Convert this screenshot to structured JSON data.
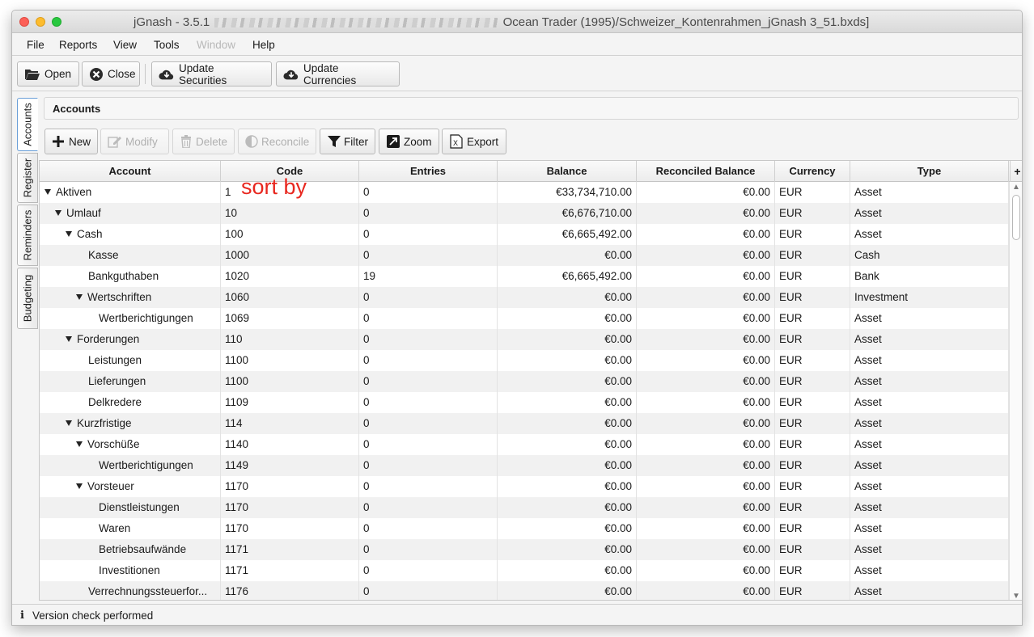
{
  "window": {
    "title_prefix": "jGnash - 3.5.1",
    "title_suffix": "Ocean Trader (1995)/Schweizer_Kontenrahmen_jGnash 3_51.bxds]"
  },
  "menu": {
    "file": "File",
    "reports": "Reports",
    "view": "View",
    "tools": "Tools",
    "window": "Window",
    "help": "Help"
  },
  "toolbar": {
    "open": "Open",
    "close": "Close",
    "update_securities": "Update Securities",
    "update_currencies": "Update Currencies"
  },
  "side_tabs": {
    "accounts": "Accounts",
    "register": "Register",
    "reminders": "Reminders",
    "budgeting": "Budgeting"
  },
  "panel": {
    "title": "Accounts"
  },
  "account_toolbar": {
    "new": "New",
    "modify": "Modify",
    "delete": "Delete",
    "reconcile": "Reconcile",
    "filter": "Filter",
    "zoom": "Zoom",
    "export": "Export"
  },
  "table": {
    "columns": [
      "Account",
      "Code",
      "Entries",
      "Balance",
      "Reconciled Balance",
      "Currency",
      "Type"
    ],
    "add_column": "+",
    "rows": [
      {
        "account": "Aktiven",
        "level": 0,
        "expanded": true,
        "code": "1",
        "entries": "0",
        "balance": "€33,734,710.00",
        "reconciled": "€0.00",
        "currency": "EUR",
        "type": "Asset"
      },
      {
        "account": "Umlauf",
        "level": 1,
        "expanded": true,
        "code": "10",
        "entries": "0",
        "balance": "€6,676,710.00",
        "reconciled": "€0.00",
        "currency": "EUR",
        "type": "Asset"
      },
      {
        "account": "Cash",
        "level": 2,
        "expanded": true,
        "code": "100",
        "entries": "0",
        "balance": "€6,665,492.00",
        "reconciled": "€0.00",
        "currency": "EUR",
        "type": "Asset"
      },
      {
        "account": "Kasse",
        "level": 3,
        "expanded": false,
        "code": "1000",
        "entries": "0",
        "balance": "€0.00",
        "reconciled": "€0.00",
        "currency": "EUR",
        "type": "Cash"
      },
      {
        "account": "Bankguthaben",
        "level": 3,
        "expanded": false,
        "code": "1020",
        "entries": "19",
        "balance": "€6,665,492.00",
        "reconciled": "€0.00",
        "currency": "EUR",
        "type": "Bank"
      },
      {
        "account": "Wertschriften",
        "level": 3,
        "expanded": true,
        "code": "1060",
        "entries": "0",
        "balance": "€0.00",
        "reconciled": "€0.00",
        "currency": "EUR",
        "type": "Investment"
      },
      {
        "account": "Wertberichtigungen",
        "level": 4,
        "expanded": false,
        "code": "1069",
        "entries": "0",
        "balance": "€0.00",
        "reconciled": "€0.00",
        "currency": "EUR",
        "type": "Asset"
      },
      {
        "account": "Forderungen",
        "level": 2,
        "expanded": true,
        "code": "110",
        "entries": "0",
        "balance": "€0.00",
        "reconciled": "€0.00",
        "currency": "EUR",
        "type": "Asset"
      },
      {
        "account": "Leistungen",
        "level": 3,
        "expanded": false,
        "code": "1100",
        "entries": "0",
        "balance": "€0.00",
        "reconciled": "€0.00",
        "currency": "EUR",
        "type": "Asset"
      },
      {
        "account": "Lieferungen",
        "level": 3,
        "expanded": false,
        "code": "1100",
        "entries": "0",
        "balance": "€0.00",
        "reconciled": "€0.00",
        "currency": "EUR",
        "type": "Asset"
      },
      {
        "account": "Delkredere",
        "level": 3,
        "expanded": false,
        "code": "1109",
        "entries": "0",
        "balance": "€0.00",
        "reconciled": "€0.00",
        "currency": "EUR",
        "type": "Asset"
      },
      {
        "account": "Kurzfristige",
        "level": 2,
        "expanded": true,
        "code": "114",
        "entries": "0",
        "balance": "€0.00",
        "reconciled": "€0.00",
        "currency": "EUR",
        "type": "Asset"
      },
      {
        "account": "Vorschüße",
        "level": 3,
        "expanded": true,
        "code": "1140",
        "entries": "0",
        "balance": "€0.00",
        "reconciled": "€0.00",
        "currency": "EUR",
        "type": "Asset"
      },
      {
        "account": "Wertberichtigungen",
        "level": 4,
        "expanded": false,
        "code": "1149",
        "entries": "0",
        "balance": "€0.00",
        "reconciled": "€0.00",
        "currency": "EUR",
        "type": "Asset"
      },
      {
        "account": "Vorsteuer",
        "level": 3,
        "expanded": true,
        "code": "1170",
        "entries": "0",
        "balance": "€0.00",
        "reconciled": "€0.00",
        "currency": "EUR",
        "type": "Asset"
      },
      {
        "account": "Dienstleistungen",
        "level": 4,
        "expanded": false,
        "code": "1170",
        "entries": "0",
        "balance": "€0.00",
        "reconciled": "€0.00",
        "currency": "EUR",
        "type": "Asset"
      },
      {
        "account": "Waren",
        "level": 4,
        "expanded": false,
        "code": "1170",
        "entries": "0",
        "balance": "€0.00",
        "reconciled": "€0.00",
        "currency": "EUR",
        "type": "Asset"
      },
      {
        "account": "Betriebsaufwände",
        "level": 4,
        "expanded": false,
        "code": "1171",
        "entries": "0",
        "balance": "€0.00",
        "reconciled": "€0.00",
        "currency": "EUR",
        "type": "Asset"
      },
      {
        "account": "Investitionen",
        "level": 4,
        "expanded": false,
        "code": "1171",
        "entries": "0",
        "balance": "€0.00",
        "reconciled": "€0.00",
        "currency": "EUR",
        "type": "Asset"
      },
      {
        "account": "Verrechnungssteuerfor...",
        "level": 3,
        "expanded": false,
        "code": "1176",
        "entries": "0",
        "balance": "€0.00",
        "reconciled": "€0.00",
        "currency": "EUR",
        "type": "Asset"
      }
    ]
  },
  "annotation": "sort by",
  "status": {
    "icon": "info-icon",
    "text": "Version check performed"
  },
  "colors": {
    "annotation": "#e8271f",
    "active_tab_border": "#6a9fd8"
  }
}
